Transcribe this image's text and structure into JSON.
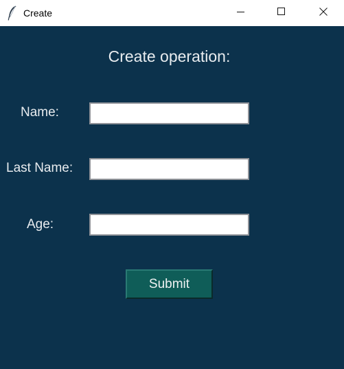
{
  "window": {
    "title": "Create",
    "app_icon": "feather-icon",
    "controls": {
      "minimize_icon": "minimize-icon",
      "maximize_icon": "maximize-icon",
      "close_icon": "close-icon"
    }
  },
  "form": {
    "heading": "Create operation:",
    "fields": [
      {
        "label": "Name:",
        "value": "",
        "placeholder": ""
      },
      {
        "label": "Last Name:",
        "value": "",
        "placeholder": ""
      },
      {
        "label": "Age:",
        "value": "",
        "placeholder": ""
      }
    ],
    "submit_label": "Submit"
  },
  "colors": {
    "background": "#0c324c",
    "text": "#e8ecef",
    "button": "#0f5d58"
  }
}
